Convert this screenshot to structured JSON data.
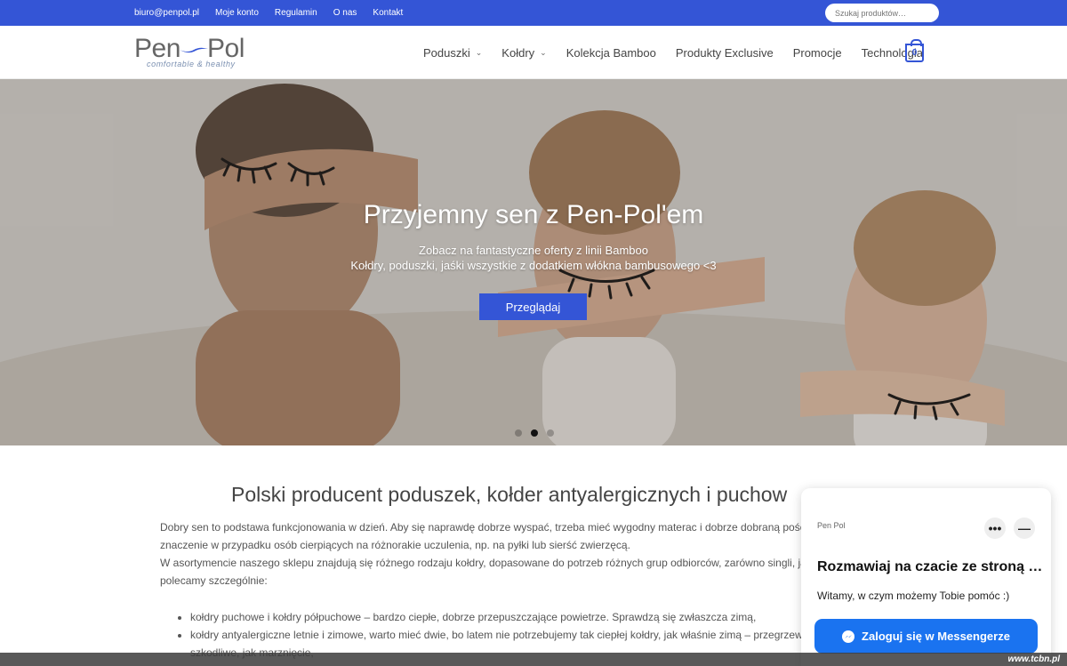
{
  "topbar": {
    "links": [
      "biuro@penpol.pl",
      "Moje konto",
      "Regulamin",
      "O nas",
      "Kontakt"
    ],
    "search_placeholder": "Szukaj produktów…",
    "color": "#3455d6"
  },
  "header": {
    "logo": {
      "word1": "Pen",
      "word2": "Pol",
      "tagline": "comfortable & healthy"
    },
    "nav": [
      {
        "label": "Poduszki",
        "dropdown": true
      },
      {
        "label": "Kołdry",
        "dropdown": true
      },
      {
        "label": "Kolekcja Bamboo",
        "dropdown": false
      },
      {
        "label": "Produkty Exclusive",
        "dropdown": false
      },
      {
        "label": "Promocje",
        "dropdown": false
      },
      {
        "label": "Technologia",
        "dropdown": false
      }
    ],
    "cart_count": "0"
  },
  "hero": {
    "title": "Przyjemny sen z Pen-Pol'em",
    "subtitle_line1": "Zobacz na fantastyczne oferty z linii Bamboo",
    "subtitle_line2": "Kołdry, poduszki, jaśki wszystkie z dodatkiem włókna bambusowego <3",
    "button": "Przeglądaj",
    "slides": 3,
    "active_slide": 2
  },
  "content": {
    "heading": "Polski producent poduszek, kołder antyalergicznych i puchow",
    "paragraphs": [
      "Dobry sen to podstawa funkcjonowania w dzień. Aby się naprawdę dobrze wyspać, trzeba mieć wygodny materac i dobrze dobraną pościel.",
      "znaczenie w przypadku osób cierpiących na różnorakie uczulenia, np. na pyłki lub sierść zwierzęcą.",
      "W asortymencie naszego sklepu znajdują się różnego rodzaju kołdry, dopasowane do potrzeb różnych grup odbiorców, zarówno singli, jak i",
      "polecamy szczególnie:"
    ],
    "list": [
      "kołdry puchowe i kołdry półpuchowe – bardzo ciepłe, dobrze przepuszczające powietrze. Sprawdzą się zwłaszcza zimą,",
      "kołdry antyalergiczne letnie i zimowe, warto mieć dwie, bo latem nie potrzebujemy tak ciepłej kołdry, jak właśnie zimą – przegrzewan",
      "szkodliwe, jak marznięcie,"
    ]
  },
  "chat": {
    "logo": "Pen Pol",
    "title": "Rozmawiaj na czacie ze stroną …",
    "welcome": "Witamy, w czym możemy Tobie pomóc :)",
    "login_button": "Zaloguj się w Messengerze",
    "more_icon": "•••",
    "minimize_icon": "—",
    "button_color": "#1a73f0"
  },
  "watermark": "www.tcbn.pl"
}
